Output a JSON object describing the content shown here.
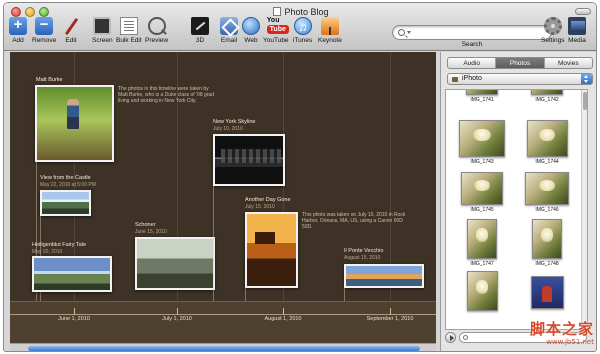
{
  "window": {
    "title": "Photo Blog"
  },
  "toolbar": {
    "items": [
      {
        "id": "add",
        "label": "Add",
        "icon": "add-icon"
      },
      {
        "id": "remove",
        "label": "Remove",
        "icon": "remove-icon"
      },
      {
        "id": "edit",
        "label": "Edit",
        "icon": "pencil-icon"
      },
      {
        "id": "screen",
        "label": "Screen",
        "icon": "screen-icon"
      },
      {
        "id": "bulk",
        "label": "Bulk Edit",
        "icon": "bulk-edit-icon"
      },
      {
        "id": "preview",
        "label": "Preview",
        "icon": "magnifier-icon"
      },
      {
        "id": "3d",
        "label": "3D",
        "icon": "3d-icon"
      },
      {
        "id": "email",
        "label": "Email",
        "icon": "email-icon"
      },
      {
        "id": "web",
        "label": "Web",
        "icon": "globe-icon"
      },
      {
        "id": "youtube",
        "label": "YouTube",
        "icon": "youtube-icon",
        "logo_top": "You",
        "logo_bottom": "Tube"
      },
      {
        "id": "itunes",
        "label": "iTunes",
        "icon": "itunes-icon"
      },
      {
        "id": "keynote",
        "label": "Keynote",
        "icon": "keynote-icon"
      },
      {
        "id": "settings",
        "label": "Settings",
        "icon": "gear-icon"
      },
      {
        "id": "media",
        "label": "Media",
        "icon": "media-icon"
      }
    ],
    "search": {
      "label": "Search",
      "value": "",
      "placeholder": ""
    }
  },
  "timeline": {
    "axis_labels": [
      "June 1, 2010",
      "July 1, 2010",
      "August 1, 2010",
      "September 1, 2010"
    ],
    "events": [
      {
        "title": "Matt Burke",
        "date": "",
        "description": "The photos in this timeline were taken by Matt Burke, who is a Duke class of '08 grad living and working in New York City."
      },
      {
        "title": "View from the Castle",
        "date": "May 22, 2010 at 5:00 PM",
        "description": ""
      },
      {
        "title": "Heiligenblut Fairy Tale",
        "date": "May 20, 2010",
        "description": ""
      },
      {
        "title": "Schoner",
        "date": "June 15, 2010",
        "description": ""
      },
      {
        "title": "New York Skyline",
        "date": "July 10, 2010",
        "description": ""
      },
      {
        "title": "Another Day Gone",
        "date": "July 15, 2010",
        "description": "This photo was taken on July 15, 2010 in Rock Harbor, Orleans, MA, US, using a Canon 60D 50D."
      },
      {
        "title": "Il Ponte Vecchio",
        "date": "August 15, 2010",
        "description": ""
      }
    ]
  },
  "panel": {
    "tabs": [
      "Audio",
      "Photos",
      "Movies"
    ],
    "active_tab": "Photos",
    "source": "iPhoto",
    "thumbnails": [
      "IMG_1741",
      "IMG_1742",
      "IMG_1743",
      "IMG_1744",
      "IMG_1745",
      "IMG_1746",
      "IMG_1747",
      "IMG_1748",
      "",
      ""
    ],
    "search": {
      "value": "",
      "placeholder": ""
    }
  },
  "watermark": {
    "text": "脚本之家",
    "url": "www.jb51.net"
  },
  "colors": {
    "timeline_bg": "#3e3226",
    "axis_bg": "#4f4130",
    "accent_blue": "#3b79d0",
    "watermark": "#d64a2b"
  }
}
